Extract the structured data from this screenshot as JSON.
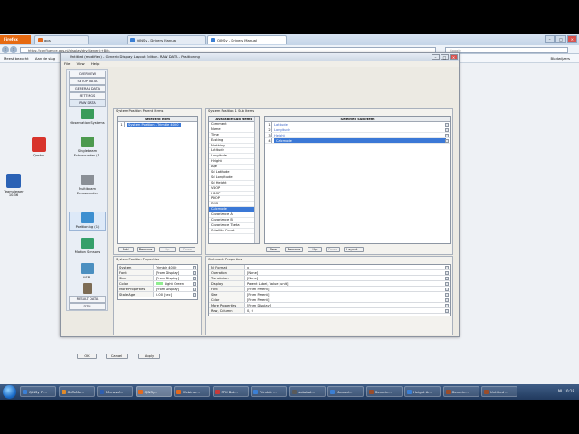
{
  "browser": {
    "tabs": [
      {
        "label": "Firefox",
        "kind": "menu"
      },
      {
        "label": "qps",
        "kind": "tab"
      },
      {
        "label": "QINSy - Drivers Manual",
        "kind": "tab"
      },
      {
        "label": "QINSy - Drivers Manual",
        "kind": "tab",
        "active": true
      }
    ],
    "address": "https://confluence.qps.nl/display/drv/Generic+Bits",
    "search_placeholder": "Google",
    "bookmarks": [
      "Meest bezocht",
      "Aan de slag",
      "Laatste nieuws",
      "Confluence",
      "QPS JIRA"
    ],
    "bookmarks_right": "Bladwijzers"
  },
  "desktop_icons": [
    {
      "label": "Qastor",
      "color": "#d8342c"
    },
    {
      "label": "Teamviewer 10.36",
      "color": "#2b62b5"
    }
  ],
  "app": {
    "title": "Untitled (modified) - Generic Display Layout Editor - RAW DATA - Positioning",
    "menu": [
      "File",
      "View",
      "Help"
    ],
    "nav_buttons": [
      "OVERVIEW",
      "SETUP DATA",
      "GENERAL DATA",
      "SETTINGS",
      "RAW DATA"
    ],
    "nav_items": [
      {
        "label": "Observation Systems",
        "color": "#3a9c5a"
      },
      {
        "label": "Singlebeam Echosounder (1)",
        "color": "#4d9a4f"
      },
      {
        "label": "Multibeam Echosounder",
        "color": "#8a8f96"
      },
      {
        "label": "Positioning (1)",
        "color": "#3d8fd0",
        "selected": true
      },
      {
        "label": "Motion Sensors",
        "color": "#35a06a"
      },
      {
        "label": "USBL",
        "color": "#4b8fc0"
      },
      {
        "label": "Leadline",
        "color": "#7d6c55"
      }
    ],
    "nav_bottom": [
      "RESULT DATA",
      "DTM"
    ],
    "parent_items": {
      "label": "System Position Parent Items",
      "header": "Selected Item",
      "rows": [
        {
          "num": "1",
          "text": "System Position - Trimble 4000",
          "selected": true
        }
      ],
      "buttons": [
        "Add",
        "Remove",
        "Up",
        "Down"
      ]
    },
    "sub_items": {
      "label": "System Position 1 Sub Items",
      "available_header": "Available Sub Items",
      "available": [
        "Comment",
        "Name",
        "Time",
        "Easting",
        "Northing",
        "Latitude",
        "Longitude",
        "Height",
        "Age",
        "Sd Latitude",
        "Sd Longitude",
        "Sd Height",
        "VDOP",
        "HDOP",
        "PDOP",
        "RMS",
        "Calcmode",
        "Covariance A",
        "Covariance B",
        "Covariance Theta",
        "Satellite Count"
      ],
      "available_selected": "Calcmode",
      "selected_header": "Selected Sub Item",
      "selected": [
        {
          "num": "1",
          "text": "Latitude"
        },
        {
          "num": "2",
          "text": "Longitude"
        },
        {
          "num": "3",
          "text": "Height"
        },
        {
          "num": "4",
          "text": "Calcmode",
          "selected": true
        }
      ],
      "buttons": [
        "New",
        "Remove",
        "Up",
        "Down",
        "Layout..."
      ]
    },
    "parent_props": {
      "label": "System Position Properties",
      "rows": [
        {
          "k": "System",
          "v": "Trimble 4000"
        },
        {
          "k": "Font",
          "v": "[From Display]"
        },
        {
          "k": "Size",
          "v": "[From Display]"
        },
        {
          "k": "Color",
          "v": "Light Green",
          "swatch": "#90ee90"
        },
        {
          "k": "More Properties",
          "v": "[From Display]"
        },
        {
          "k": "Stale Age",
          "v": "0.00 [sec]"
        }
      ]
    },
    "sub_props": {
      "label": "Calcmode Properties",
      "rows": [
        {
          "k": "Nr Format",
          "v": "x"
        },
        {
          "k": "Operation",
          "v": "[None]"
        },
        {
          "k": "Translation",
          "v": "[None]"
        },
        {
          "k": "Display",
          "v": "Parent Label, Value [unit]"
        },
        {
          "k": "Font",
          "v": "[From Parent]"
        },
        {
          "k": "Size",
          "v": "[From Parent]"
        },
        {
          "k": "Color",
          "v": "[From Parent]"
        },
        {
          "k": "More Properties",
          "v": "[From Display]"
        },
        {
          "k": "Row, Column",
          "v": "0, 0"
        }
      ]
    },
    "footer_buttons": [
      "OK",
      "Cancel",
      "Apply"
    ]
  },
  "taskbar": {
    "items": [
      {
        "label": "QINSy Pr...",
        "color": "#3b7fd4"
      },
      {
        "label": "GoToMe...",
        "color": "#e08a2a"
      },
      {
        "label": "Microsof...",
        "color": "#2f5fb0"
      },
      {
        "label": "QINSy...",
        "color": "#e36a1e",
        "active": true
      },
      {
        "label": "Webinar...",
        "color": "#e36a1e"
      },
      {
        "label": "PPK Bet...",
        "color": "#c63a3a"
      },
      {
        "label": "Trimble ...",
        "color": "#3b7fd4"
      },
      {
        "label": "Autobot...",
        "color": "#5a5a5a"
      },
      {
        "label": "Manual...",
        "color": "#3b7fd4"
      },
      {
        "label": "Generic...",
        "color": "#9a4d2b"
      },
      {
        "label": "Height A...",
        "color": "#3b7fd4"
      },
      {
        "label": "Generic...",
        "color": "#9a4d2b"
      },
      {
        "label": "Untitled ...",
        "color": "#9a4d2b"
      }
    ],
    "tray": "NL  10:18"
  }
}
